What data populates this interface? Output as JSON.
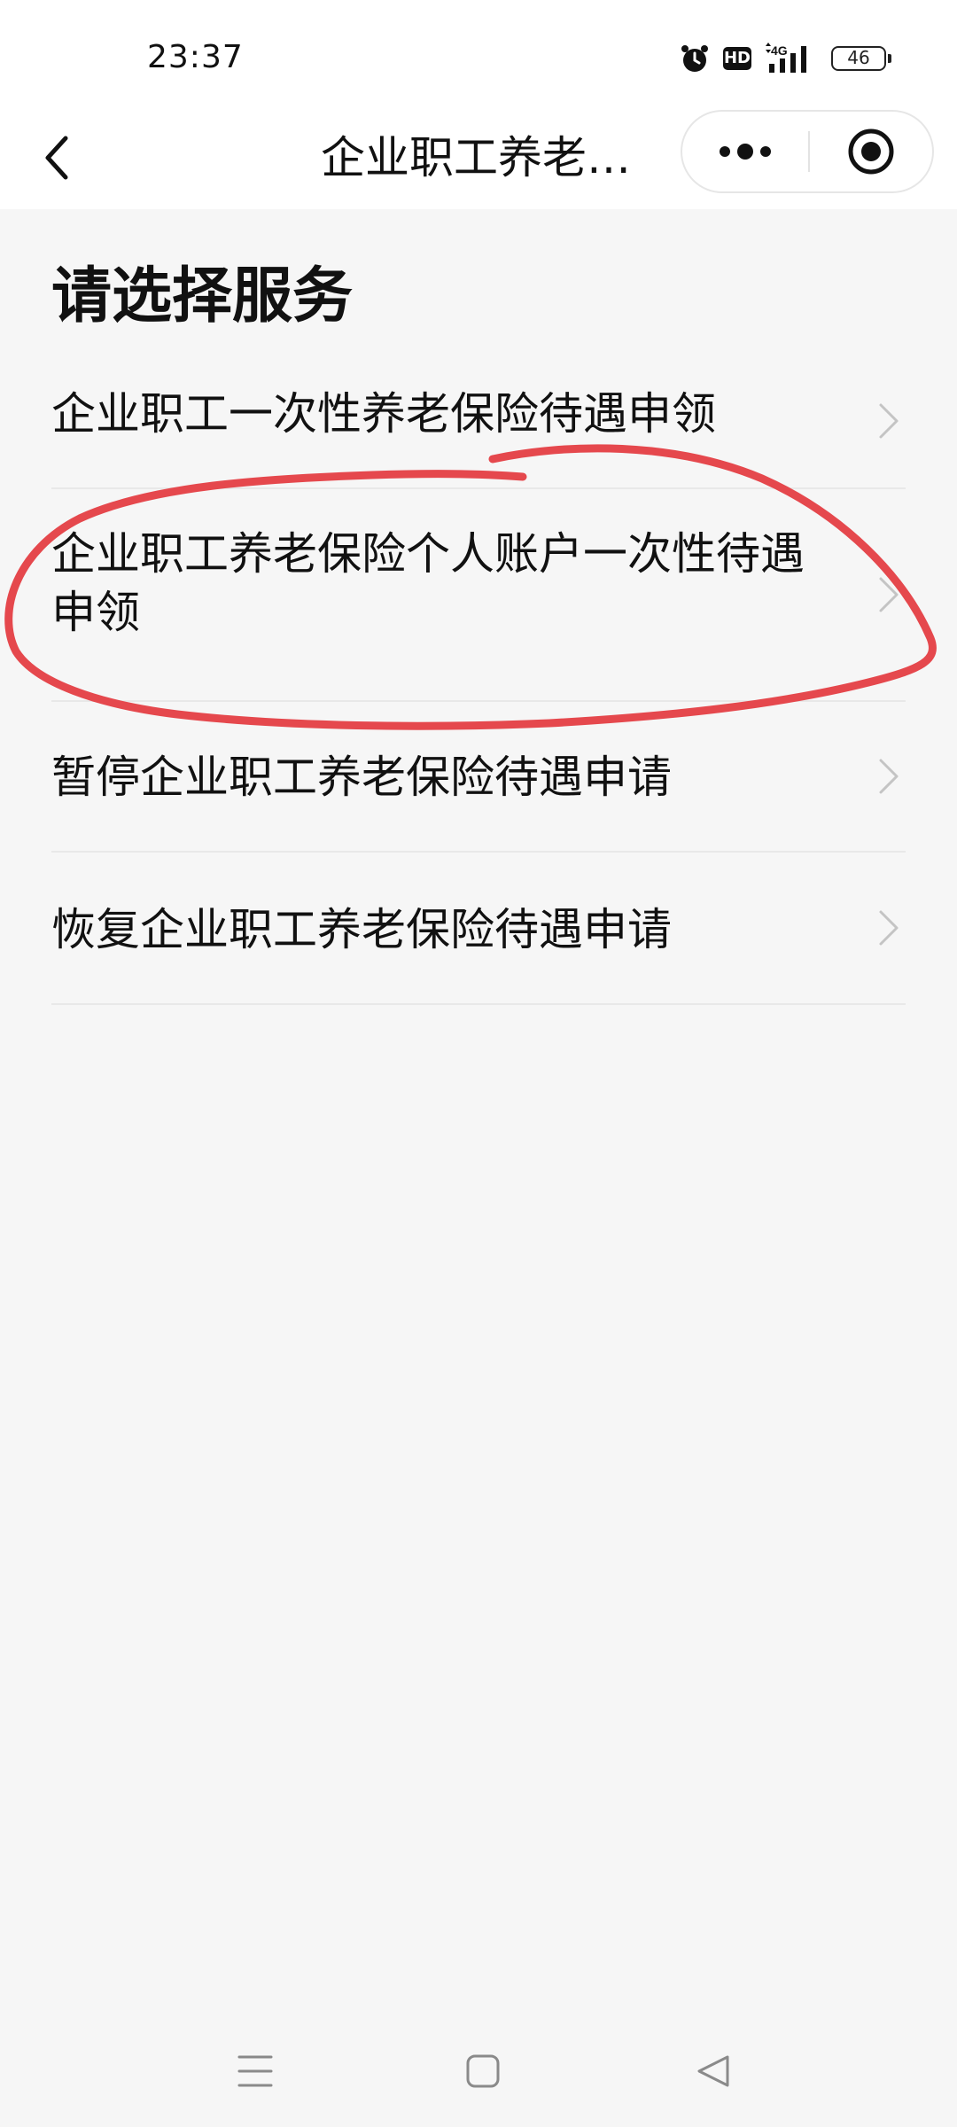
{
  "status_bar": {
    "time": "23:37",
    "hd_label": "HD",
    "network_label": "4G",
    "battery_level": "46",
    "icons": [
      "alarm-icon",
      "hd-icon",
      "signal-4g-icon",
      "battery-icon"
    ]
  },
  "nav_bar": {
    "title": "企业职工养老…",
    "icons": [
      "back-icon",
      "more-icon",
      "close-miniprogram-icon"
    ]
  },
  "page": {
    "section_title": "请选择服务",
    "services": [
      {
        "label": "企业职工一次性养老保险待遇申领"
      },
      {
        "label": "企业职工养老保险个人账户一次性待遇\n申领"
      },
      {
        "label": "暂停企业职工养老保险待遇申请"
      },
      {
        "label": "恢复企业职工养老保险待遇申请"
      }
    ]
  },
  "annotation": {
    "shape": "hand-drawn circle around second service item",
    "color": "#e5484d"
  },
  "system_nav": {
    "icons": [
      "menu-icon",
      "home-icon",
      "back-triangle-icon"
    ]
  },
  "colors": {
    "background": "#f6f6f6",
    "bar": "#ffffff",
    "divider": "#e8e8e8",
    "chevron": "#c4c4c4"
  }
}
